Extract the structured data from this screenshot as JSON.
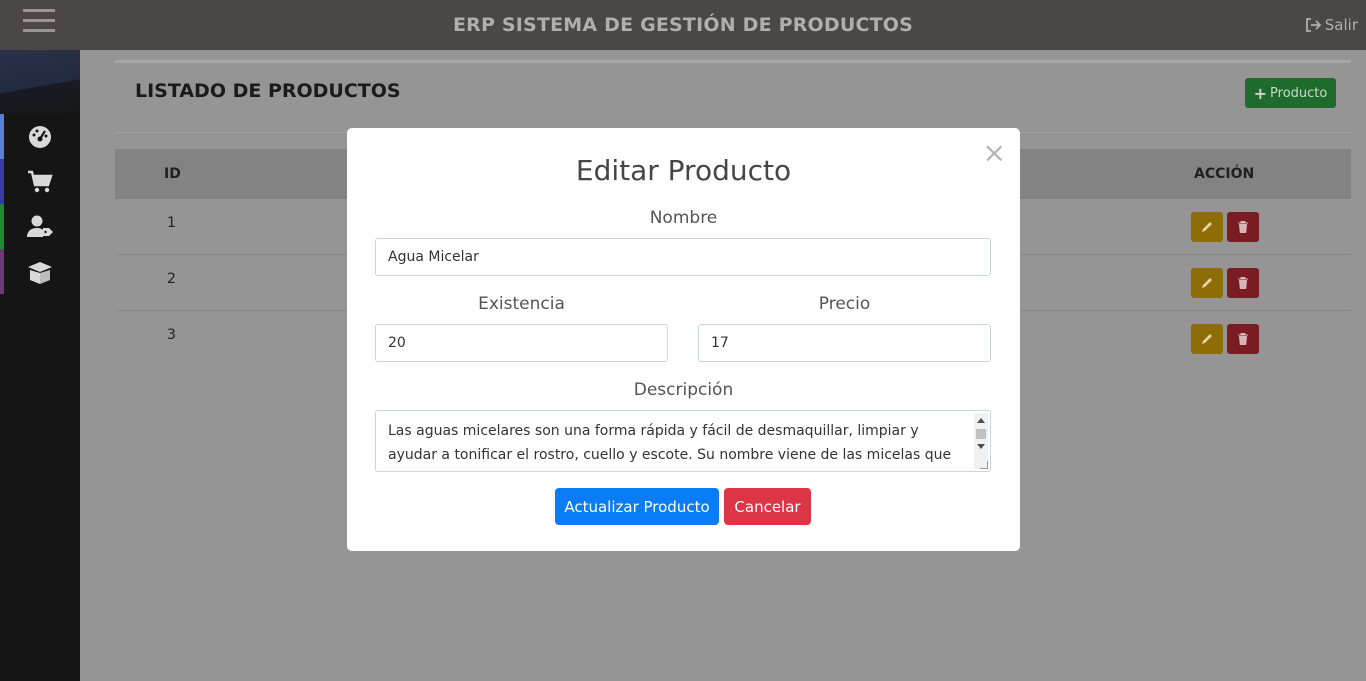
{
  "header": {
    "title": "ERP SISTEMA DE GESTIÓN DE PRODUCTOS",
    "logout_label": "Salir"
  },
  "sidebar": {
    "items": [
      {
        "icon": "dashboard-icon",
        "accent": "#5b7fd6"
      },
      {
        "icon": "cart-icon",
        "accent": "#3a3aa8"
      },
      {
        "icon": "user-tag-icon",
        "accent": "#1e8a2e"
      },
      {
        "icon": "box-open-icon",
        "accent": "#6a3a7a"
      }
    ]
  },
  "main": {
    "title": "LISTADO DE PRODUCTOS",
    "add_button_label": "Producto",
    "table": {
      "headers": {
        "id": "ID",
        "action": "ACCIÓN"
      },
      "rows": [
        {
          "id": "1"
        },
        {
          "id": "2"
        },
        {
          "id": "3"
        }
      ]
    }
  },
  "modal": {
    "title": "Editar Producto",
    "close_glyph": "×",
    "nombre_label": "Nombre",
    "nombre_value": "Agua Micelar",
    "existencia_label": "Existencia",
    "existencia_value": "20",
    "precio_label": "Precio",
    "precio_value": "17",
    "descripcion_label": "Descripción",
    "descripcion_value": "Las aguas micelares son una forma rápida y fácil de desmaquillar, limpiar y ayudar a tonificar el rostro, cuello y escote. Su nombre viene de las micelas que",
    "update_button": "Actualizar Producto",
    "cancel_button": "Cancelar"
  },
  "colors": {
    "topbar": "#4a4745",
    "primary": "#0a7cf5",
    "danger": "#dc3545",
    "success": "#28a745",
    "warning": "#ffc107"
  }
}
